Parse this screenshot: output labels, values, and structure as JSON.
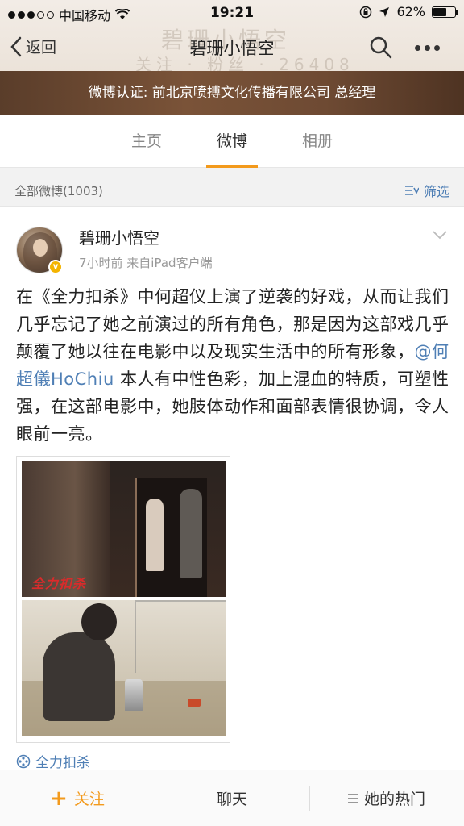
{
  "status_bar": {
    "carrier": "中国移动",
    "time": "19:21",
    "battery_percent": "62%",
    "battery_level": 0.62
  },
  "header": {
    "back_label": "返回",
    "title": "碧珊小悟空",
    "verification": "微博认证: 前北京喷搏文化传播有限公司 总经理"
  },
  "tabs": [
    {
      "label": "主页",
      "active": false
    },
    {
      "label": "微博",
      "active": true
    },
    {
      "label": "相册",
      "active": false
    }
  ],
  "filter": {
    "count_label": "全部微博(1003)",
    "filter_label": "筛选"
  },
  "post": {
    "author": "碧珊小悟空",
    "meta": "7小时前  来自iPad客户端",
    "text_before": "在《全力扣杀》中何超仪上演了逆袭的好戏，从而让我们几乎忘记了她之前演过的所有角色，那是因为这部戏几乎颠覆了她以往在电影中以及现实生活中的所有形象，",
    "mention": "@何超儀HoChiu",
    "text_after": " 本人有中性色彩，加上混血的特质，可塑性强，在这部电影中，她肢体动作和面部表情很协调，令人眼前一亮。",
    "photo_logo_text": "全力扣杀",
    "topic": "全力扣杀"
  },
  "bottom_bar": {
    "follow": "关注",
    "chat": "聊天",
    "hot": "她的热门"
  },
  "colors": {
    "accent": "#f39a1c",
    "link": "#4f7fb5",
    "verify_bar": "#6e4a33"
  }
}
